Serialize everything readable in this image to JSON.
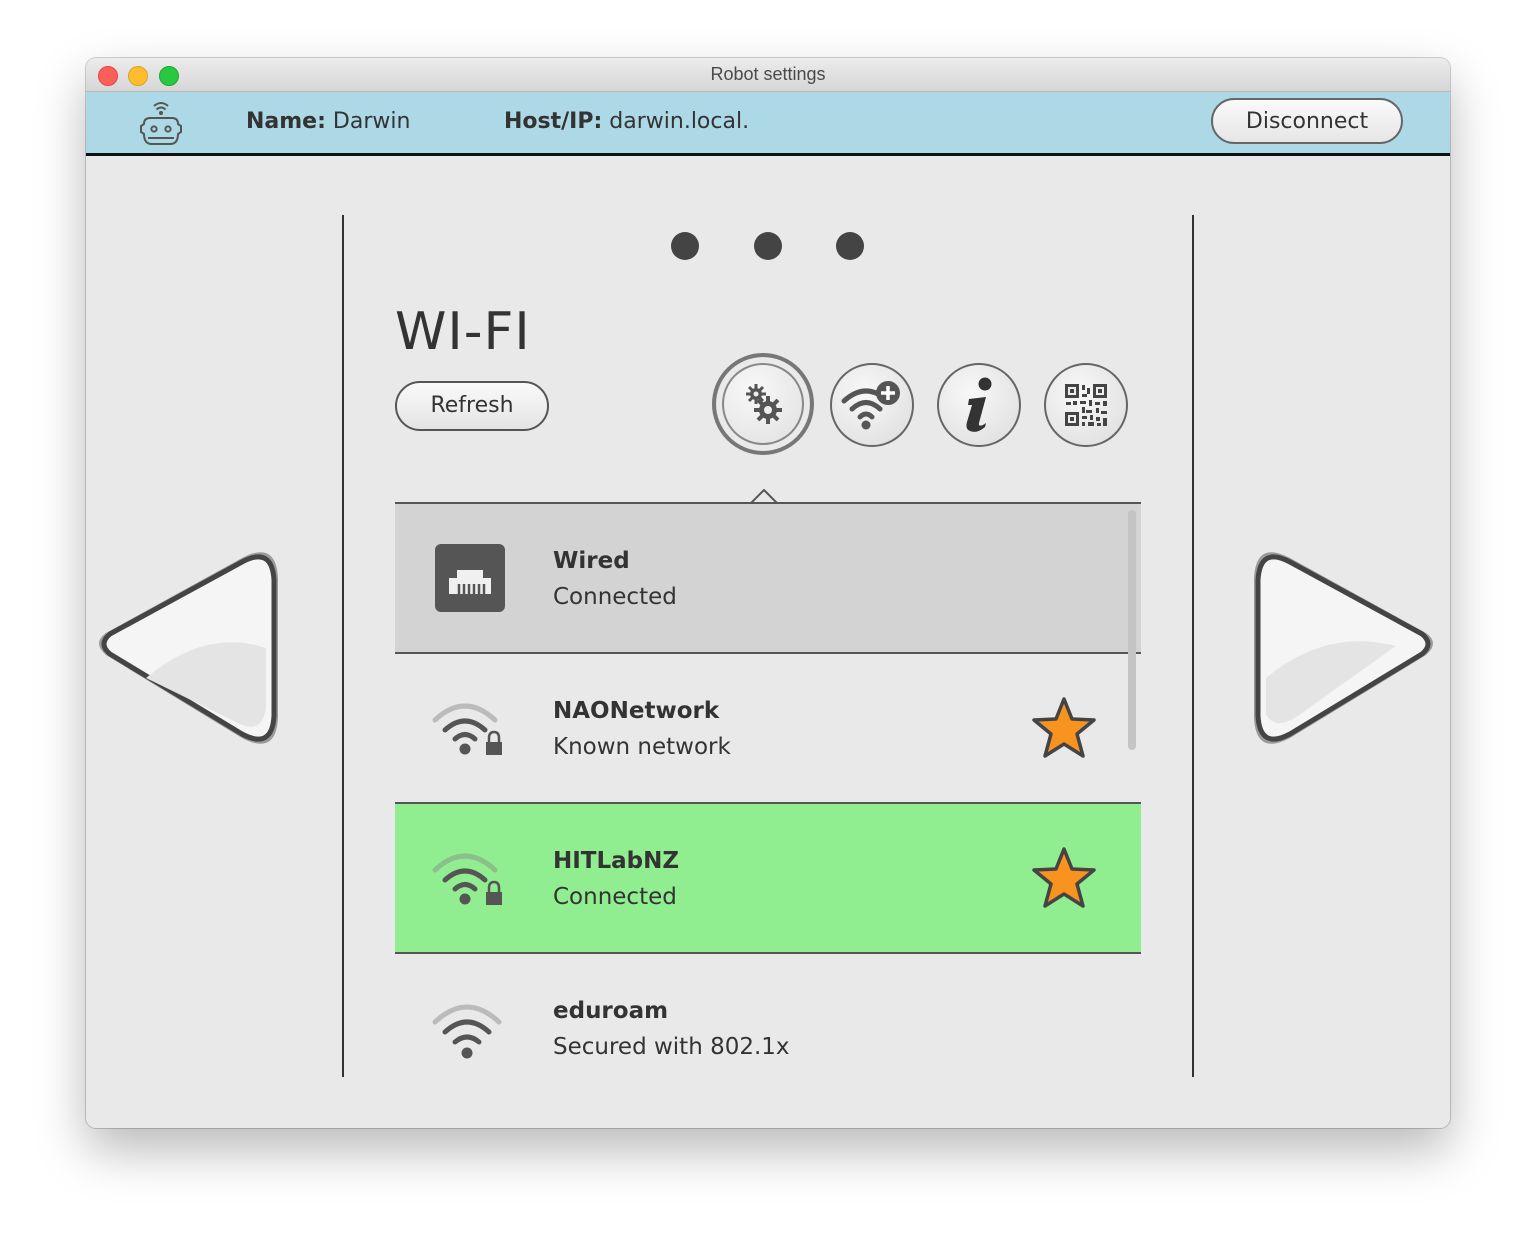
{
  "window": {
    "title": "Robot settings"
  },
  "header": {
    "name_label": "Name:",
    "name_value": "Darwin",
    "host_label": "Host/IP:",
    "host_value": "darwin.local.",
    "disconnect_label": "Disconnect",
    "robot_icon": "robot-wifi-icon"
  },
  "pager": {
    "dots": 3
  },
  "wifi": {
    "title": "WI-FI",
    "refresh_label": "Refresh",
    "toolbar": [
      {
        "icon": "settings-gears-icon",
        "active": true
      },
      {
        "icon": "wifi-add-icon",
        "active": false
      },
      {
        "icon": "info-icon",
        "active": false
      },
      {
        "icon": "qr-code-icon",
        "active": false
      }
    ],
    "networks": [
      {
        "name": "Wired",
        "status": "Connected",
        "icon": "ethernet-icon",
        "favorite": false,
        "state": "selected"
      },
      {
        "name": "NAONetwork",
        "status": "Known network",
        "icon": "wifi-locked-icon",
        "favorite": true,
        "state": "normal"
      },
      {
        "name": "HITLabNZ",
        "status": "Connected",
        "icon": "wifi-locked-icon",
        "favorite": true,
        "state": "connected"
      },
      {
        "name": "eduroam",
        "status": "Secured with 802.1x",
        "icon": "wifi-icon",
        "favorite": false,
        "state": "normal"
      }
    ]
  },
  "colors": {
    "header_bg": "#add8e6",
    "selected_row": "#d3d3d3",
    "connected_row": "#90ee90",
    "star": "#f7931e"
  }
}
